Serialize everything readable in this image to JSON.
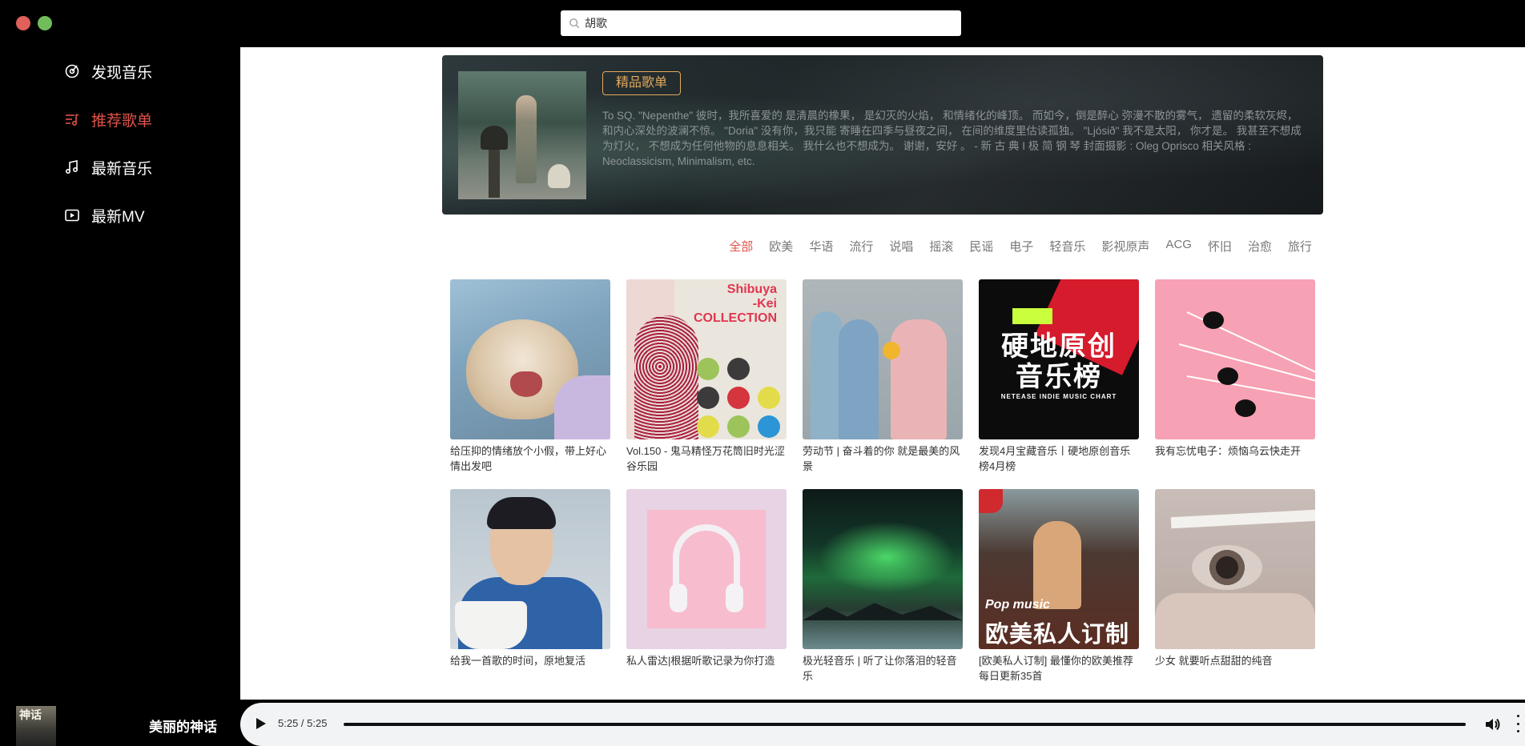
{
  "search": {
    "value": "胡歌"
  },
  "sidebar": {
    "items": [
      {
        "label": "发现音乐",
        "icon": "disc-icon",
        "active": false
      },
      {
        "label": "推荐歌单",
        "icon": "playlist-icon",
        "active": true
      },
      {
        "label": "最新音乐",
        "icon": "music-note-icon",
        "active": false
      },
      {
        "label": "最新MV",
        "icon": "video-icon",
        "active": false
      }
    ]
  },
  "banner": {
    "badge": "精品歌单",
    "description": "To SQ. \"Nepenthe\" 彼时，我所喜爱的 是清晨的橡果， 是幻灭的火焰， 和情绪化的峰顶。 而如今，倒是醉心 弥漫不散的雾气， 遗留的柔软灰烬， 和内心深处的波澜不惊。 \"Doria\" 没有你，我只能 寄睡在四季与昼夜之间， 在间的维度里估读孤独。 \"Ljósið\" 我不是太阳， 你才是。 我甚至不想成为灯火， 不想成为任何他物的息息相关。 我什么也不想成为。 谢谢，安好 。 - 新 古 典 I 极 简 钢 琴 封面摄影 : Oleg Oprisco 相关风格 : Neoclassicism, Minimalism, etc."
  },
  "tags": [
    "全部",
    "欧美",
    "华语",
    "流行",
    "说唱",
    "摇滚",
    "民谣",
    "电子",
    "轻音乐",
    "影视原声",
    "ACG",
    "怀旧",
    "治愈",
    "旅行"
  ],
  "active_tag": "全部",
  "playlists": [
    {
      "title": "给压抑的情绪放个小假，带上好心情出发吧"
    },
    {
      "title": "Vol.150 - 鬼马精怪万花筒旧时光涩谷乐园",
      "cover_text": [
        "Shibuya",
        "-Kei",
        "COLLECTION"
      ]
    },
    {
      "title": "劳动节 | 奋斗着的你 就是最美的风景"
    },
    {
      "title": "发现4月宝藏音乐丨硬地原创音乐榜4月榜",
      "cover_text": [
        "硬地原创",
        "音乐榜",
        "NETEASE INDIE MUSIC CHART"
      ]
    },
    {
      "title": "我有忘忧电子：烦恼乌云快走开"
    },
    {
      "title": "给我一首歌的时间，原地复活"
    },
    {
      "title": "私人雷达|根据听歌记录为你打造"
    },
    {
      "title": "极光轻音乐 | 听了让你落泪的轻音乐"
    },
    {
      "title": "[欧美私人订制] 最懂你的欧美推荐 每日更新35首",
      "cover_text": [
        "Pop music",
        "欧美私人订制"
      ]
    },
    {
      "title": "少女 就要听点甜甜的纯音"
    }
  ],
  "now_playing": {
    "title": "美丽的神话",
    "cover_text": "神话"
  },
  "player": {
    "time": "5:25 / 5:25",
    "progress": 1.0
  },
  "colors": {
    "accent": "#e0534a",
    "badge": "#e2a95c"
  }
}
